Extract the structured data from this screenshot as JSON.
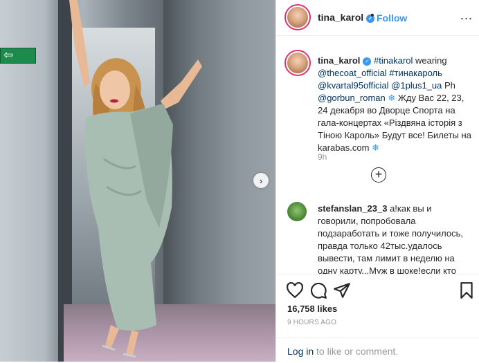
{
  "header": {
    "username": "tina_karol",
    "verified_symbol": "✓",
    "separator": "•",
    "follow_label": "Follow",
    "more_label": "..."
  },
  "caption": {
    "username": "tina_karol",
    "hashtag1": "#tinakarol",
    "text1": " wearing ",
    "mention1": "@thecoat_official",
    "hashtag2": "#тинакароль",
    "mention2": "@kvartal95official",
    "mention3": "@1plus1_ua",
    "text2": " Ph ",
    "mention4": "@gorbun_roman",
    "text3": " Жду Вас 22, 23, 24 декабря во Дворце Спорта на гала-концертах «Різдвяна історія з Тіною Кароль» Будут все! Билеты на karabas.com ",
    "snowflake": "❄",
    "time": "9h"
  },
  "load_more_symbol": "+",
  "comment": {
    "username": "stefanslan_23_3",
    "text": " а!как вы и говорили, попробовала подзаработать и тоже получилось, правда только 42тыс.удалось вывести, там лимит в неделю на одну карту...Муж в шоке!если кто"
  },
  "actions": {
    "likes": "16,758 likes",
    "time_ago": "9 HOURS AGO"
  },
  "login_prompt": {
    "link": "Log in",
    "text": " to like or comment."
  },
  "photo": {
    "exit_arrow": "⇦",
    "next_symbol": "›"
  },
  "icons": [
    "heart-icon",
    "comment-icon",
    "share-icon",
    "bookmark-icon",
    "plus-circle-icon",
    "verified-icon",
    "exit-sign-icon",
    "chevron-right-icon"
  ],
  "colors": {
    "accent": "#3897f0",
    "link": "#003569",
    "muted": "#999999",
    "text": "#262626",
    "story_ring": "#e1306c"
  }
}
